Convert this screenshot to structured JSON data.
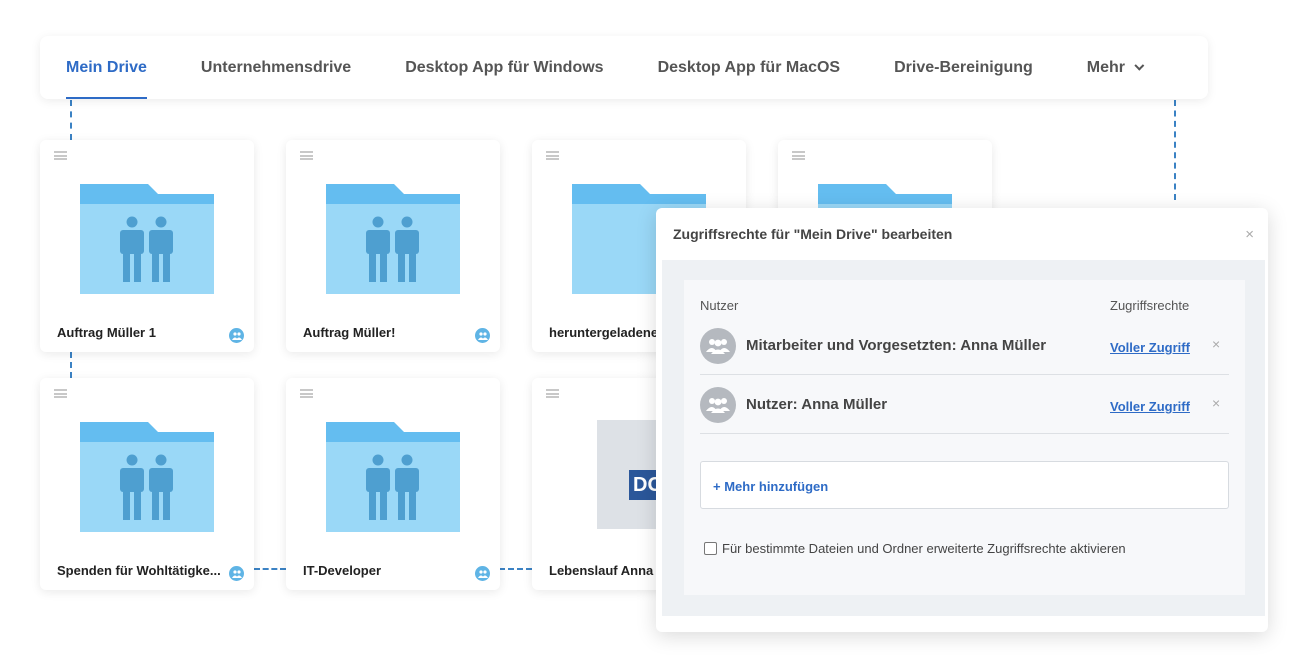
{
  "nav": {
    "tabs": [
      {
        "label": "Mein Drive",
        "active": true
      },
      {
        "label": "Unternehmensdrive"
      },
      {
        "label": "Desktop App für Windows"
      },
      {
        "label": "Desktop App für MacOS"
      },
      {
        "label": "Drive-Bereinigung"
      },
      {
        "label": "Mehr"
      }
    ]
  },
  "cards": [
    {
      "label": "Auftrag Müller 1",
      "type": "shared-folder"
    },
    {
      "label": "Auftrag Müller!",
      "type": "shared-folder"
    },
    {
      "label": "heruntergeladene",
      "type": "folder"
    },
    {
      "label": "",
      "type": "folder"
    },
    {
      "label": "Spenden für Wohltätigke...",
      "type": "shared-folder"
    },
    {
      "label": "IT-Developer",
      "type": "shared-folder"
    },
    {
      "label": "Lebenslauf Anna",
      "type": "document",
      "doc_tag": "DO"
    }
  ],
  "dialog": {
    "title": "Zugriffsrechte für \"Mein Drive\" bearbeiten",
    "close": "×",
    "col_user": "Nutzer",
    "col_access": "Zugriffsrechte",
    "rows": [
      {
        "name": "Mitarbeiter und Vorgesetzten: Anna Müller",
        "access": "Voller Zugriff",
        "remove": "×"
      },
      {
        "name": "Nutzer: Anna Müller",
        "access": "Voller Zugriff",
        "remove": "×"
      }
    ],
    "add_label": "+ Mehr hinzufügen",
    "advanced_label": "Für bestimmte Dateien und Ordner erweiterte Zugriffsrechte aktivieren"
  },
  "colors": {
    "accent": "#2e6bc6",
    "folder": "#9ad8f7",
    "folder_tab": "#64bdf0",
    "people": "#4e9fd0"
  }
}
